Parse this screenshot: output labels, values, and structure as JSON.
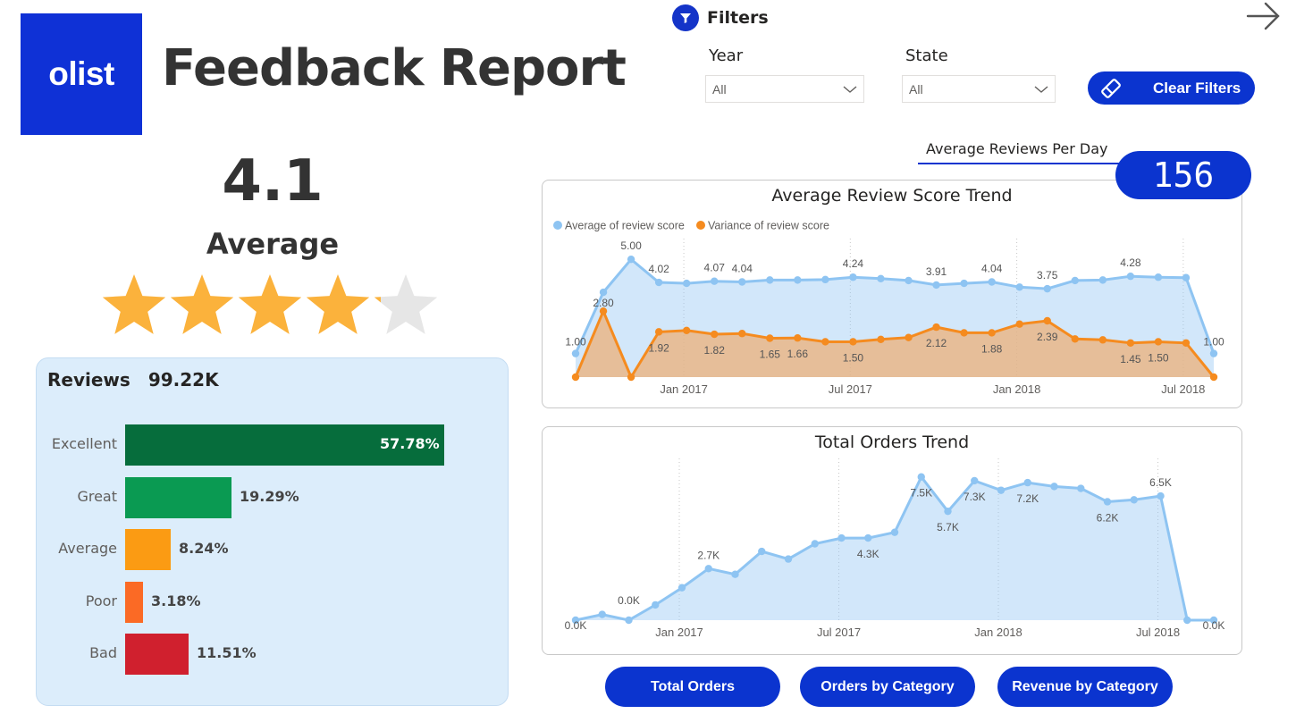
{
  "header": {
    "logo_text": "olist",
    "title": "Feedback Report"
  },
  "filters": {
    "title": "Filters",
    "year_label": "Year",
    "year_value": "All",
    "state_label": "State",
    "state_value": "All",
    "clear_label": "Clear Filters"
  },
  "summary": {
    "average_value": "4.1",
    "average_label": "Average",
    "rating_stars": 4.1,
    "max_stars": 5
  },
  "reviews": {
    "title": "Reviews",
    "total": "99.22K",
    "rows": [
      {
        "label": "Excellent",
        "value": 57.78,
        "text": "57.78%",
        "color": "#066d3c"
      },
      {
        "label": "Great",
        "value": 19.29,
        "text": "19.29%",
        "color": "#0a9a52"
      },
      {
        "label": "Average",
        "value": 8.24,
        "text": "8.24%",
        "color": "#fb9b13"
      },
      {
        "label": "Poor",
        "value": 3.18,
        "text": "3.18%",
        "color": "#fb6a25"
      },
      {
        "label": "Bad",
        "value": 11.51,
        "text": "11.51%",
        "color": "#d0202e"
      }
    ]
  },
  "kpi": {
    "label": "Average Reviews Per Day",
    "value": "156"
  },
  "colors": {
    "accent": "#0b34cf",
    "series_blue": "#8ec4f2",
    "series_orange": "#f58b1f"
  },
  "chart_data": [
    {
      "type": "area",
      "title": "Average Review Score Trend",
      "x": [
        "2016-09",
        "2016-10",
        "2016-12",
        "2017-01",
        "2017-02",
        "2017-03",
        "2017-04",
        "2017-05",
        "2017-06",
        "2017-07",
        "2017-08",
        "2017-09",
        "2017-10",
        "2017-11",
        "2017-12",
        "2018-01",
        "2018-02",
        "2018-03",
        "2018-04",
        "2018-05",
        "2018-06",
        "2018-07",
        "2018-08",
        "2018-09"
      ],
      "x_ticks": [
        "Jan 2017",
        "Jul 2017",
        "Jan 2018",
        "Jul 2018"
      ],
      "series": [
        {
          "name": "Average of review score",
          "color": "#8ec4f2",
          "values": [
            1.0,
            3.6,
            5.0,
            4.02,
            3.98,
            4.07,
            4.04,
            4.12,
            4.12,
            4.14,
            4.24,
            4.18,
            4.1,
            3.91,
            3.98,
            4.04,
            3.82,
            3.75,
            4.1,
            4.12,
            4.28,
            4.24,
            4.22,
            1.0
          ],
          "labels": {
            "0": "1.00",
            "2": "5.00",
            "3": "4.02",
            "5": "4.07",
            "6": "4.04",
            "10": "4.24",
            "13": "3.91",
            "15": "4.04",
            "17": "3.75",
            "20": "4.28",
            "23": "1.00"
          }
        },
        {
          "name": "Variance of review score",
          "color": "#f58b1f",
          "values": [
            0.0,
            2.8,
            0.0,
            1.92,
            1.98,
            1.82,
            1.85,
            1.65,
            1.66,
            1.5,
            1.5,
            1.6,
            1.68,
            2.12,
            1.88,
            1.88,
            2.25,
            2.39,
            1.62,
            1.58,
            1.45,
            1.5,
            1.45,
            0.0
          ],
          "labels": {
            "1": "2.80",
            "3": "1.92",
            "5": "1.82",
            "7": "1.65",
            "8": "1.66",
            "10": "1.50",
            "13": "2.12",
            "15": "1.88",
            "17": "2.39",
            "20": "1.45",
            "21": "1.50"
          }
        }
      ],
      "ylim": [
        0,
        5.5
      ]
    },
    {
      "type": "area",
      "title": "Total Orders Trend",
      "x": [
        "2016-09",
        "2016-10",
        "2016-12",
        "2017-01",
        "2017-02",
        "2017-03",
        "2017-04",
        "2017-05",
        "2017-06",
        "2017-07",
        "2017-08",
        "2017-09",
        "2017-10",
        "2017-11",
        "2017-12",
        "2018-01",
        "2018-02",
        "2018-03",
        "2018-04",
        "2018-05",
        "2018-06",
        "2018-07",
        "2018-08",
        "2018-09",
        "2018-10"
      ],
      "x_ticks": [
        "Jan 2017",
        "Jul 2017",
        "Jan 2018",
        "Jul 2018"
      ],
      "series": [
        {
          "name": "Total Orders",
          "color": "#8ec4f2",
          "values": [
            0,
            300,
            0,
            800,
            1700,
            2700,
            2400,
            3600,
            3200,
            4000,
            4300,
            4300,
            4600,
            7500,
            5700,
            7300,
            6800,
            7200,
            7000,
            6900,
            6200,
            6300,
            6500,
            0,
            0
          ],
          "labels": {
            "0": "0.0K",
            "2": "0.0K",
            "5": "2.7K",
            "11": "4.3K",
            "13": "7.5K",
            "14": "5.7K",
            "15": "7.3K",
            "17": "7.2K",
            "20": "6.2K",
            "22": "6.5K",
            "24": "0.0K"
          }
        }
      ],
      "ylim": [
        0,
        8000
      ]
    }
  ],
  "nav_buttons": [
    {
      "label": "Total Orders"
    },
    {
      "label": "Orders by Category"
    },
    {
      "label": "Revenue by Category"
    }
  ]
}
